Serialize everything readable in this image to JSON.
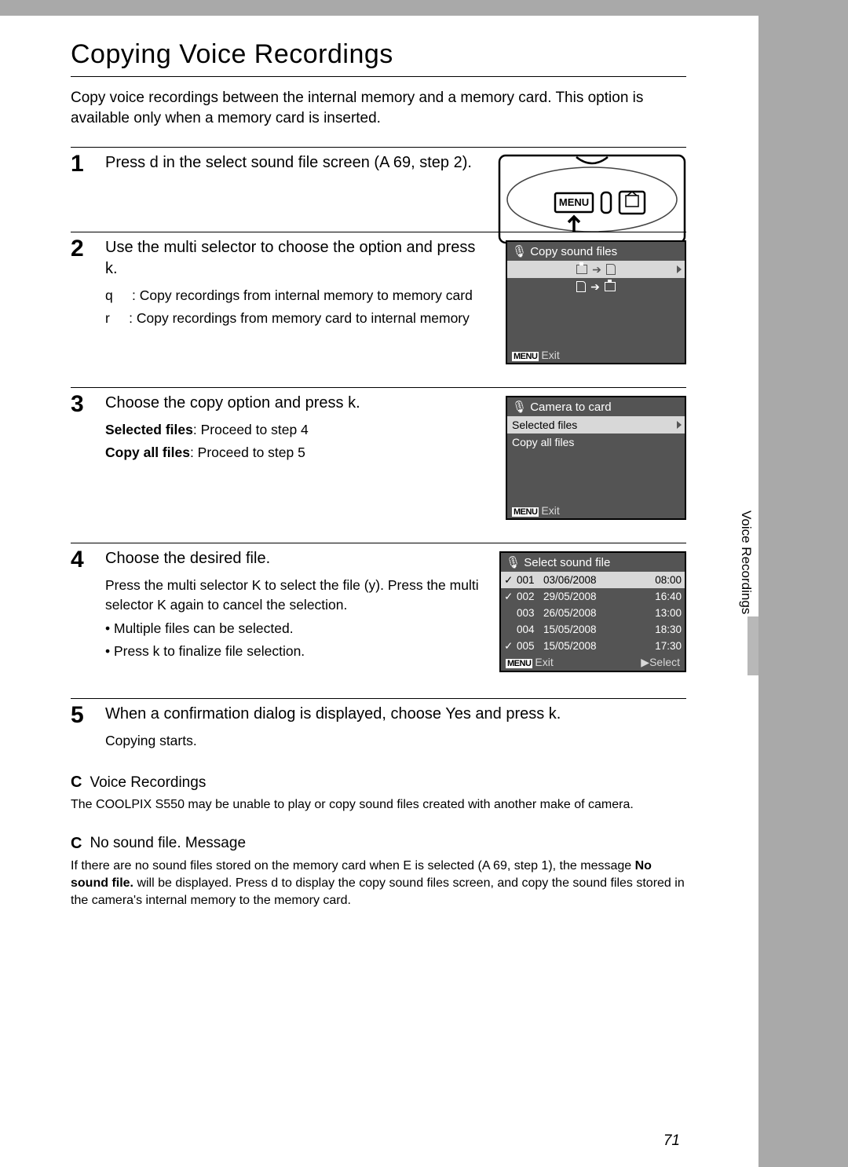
{
  "title": "Copying Voice Recordings",
  "intro": "Copy voice recordings between the internal memory and a memory card. This option is available only when a memory card is inserted.",
  "side_tab": "Voice Recordings",
  "page_number": "71",
  "steps": {
    "s1": {
      "num": "1",
      "heading": "Press d in the select sound file screen (A 69, step 2)."
    },
    "s2": {
      "num": "2",
      "heading": "Use the multi selector to choose the option and press k.",
      "line1_label": "q",
      "line1_text": ": Copy recordings from internal memory to memory card",
      "line2_label": "r",
      "line2_text": ": Copy recordings from memory card to internal memory",
      "screen_title": "Copy sound files",
      "screen_exit": "Exit"
    },
    "s3": {
      "num": "3",
      "heading": "Choose the copy option and press k.",
      "opt1_label": "Selected files",
      "opt1_text": ": Proceed to step 4",
      "opt2_label": "Copy all files",
      "opt2_text": ": Proceed to step 5",
      "screen_title": "Camera to card",
      "screen_opt1": "Selected files",
      "screen_opt2": "Copy all files",
      "screen_exit": "Exit"
    },
    "s4": {
      "num": "4",
      "heading": "Choose the desired file.",
      "desc": "Press the multi selector K to select the file (y). Press the multi selector K again to cancel the selection.",
      "bullet1": "Multiple files can be selected.",
      "bullet2": "Press k to finalize file selection.",
      "screen_title": "Select sound file",
      "screen_exit": "Exit",
      "screen_select": "Select",
      "rows": [
        {
          "mark": "✓",
          "num": "001",
          "date": "03/06/2008",
          "time": "08:00"
        },
        {
          "mark": "✓",
          "num": "002",
          "date": "29/05/2008",
          "time": "16:40"
        },
        {
          "mark": "",
          "num": "003",
          "date": "26/05/2008",
          "time": "13:00"
        },
        {
          "mark": "",
          "num": "004",
          "date": "15/05/2008",
          "time": "18:30"
        },
        {
          "mark": "✓",
          "num": "005",
          "date": "15/05/2008",
          "time": "17:30"
        }
      ]
    },
    "s5": {
      "num": "5",
      "heading": "When a confirmation dialog is displayed, choose Yes and press k.",
      "desc": "Copying starts."
    }
  },
  "notes": {
    "n1": {
      "icon": "C",
      "heading": "Voice Recordings",
      "body": "The COOLPIX S550 may be unable to play or copy sound files created with another make of camera."
    },
    "n2": {
      "icon": "C",
      "heading": "No sound file. Message",
      "body_pre": "If there are no sound files stored on the memory card when E is selected (A 69, step 1), the message ",
      "body_bold": "No sound file.",
      "body_post": " will be displayed. Press d to display the copy sound files screen, and copy the sound files stored in the camera's internal memory to the memory card."
    }
  },
  "menu_label": "MENU"
}
